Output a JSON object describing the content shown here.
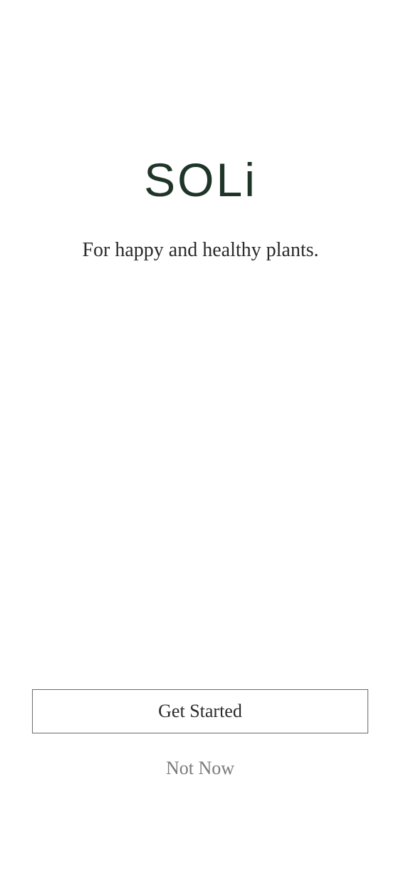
{
  "brand": {
    "logo_text": "SOLi",
    "tagline": "For happy and healthy plants."
  },
  "actions": {
    "primary_label": "Get Started",
    "secondary_label": "Not Now"
  },
  "colors": {
    "brand": "#1f3528",
    "text": "#2b2b2b",
    "muted": "#7a7a7a",
    "border": "#6b6b6b",
    "background": "#ffffff"
  }
}
